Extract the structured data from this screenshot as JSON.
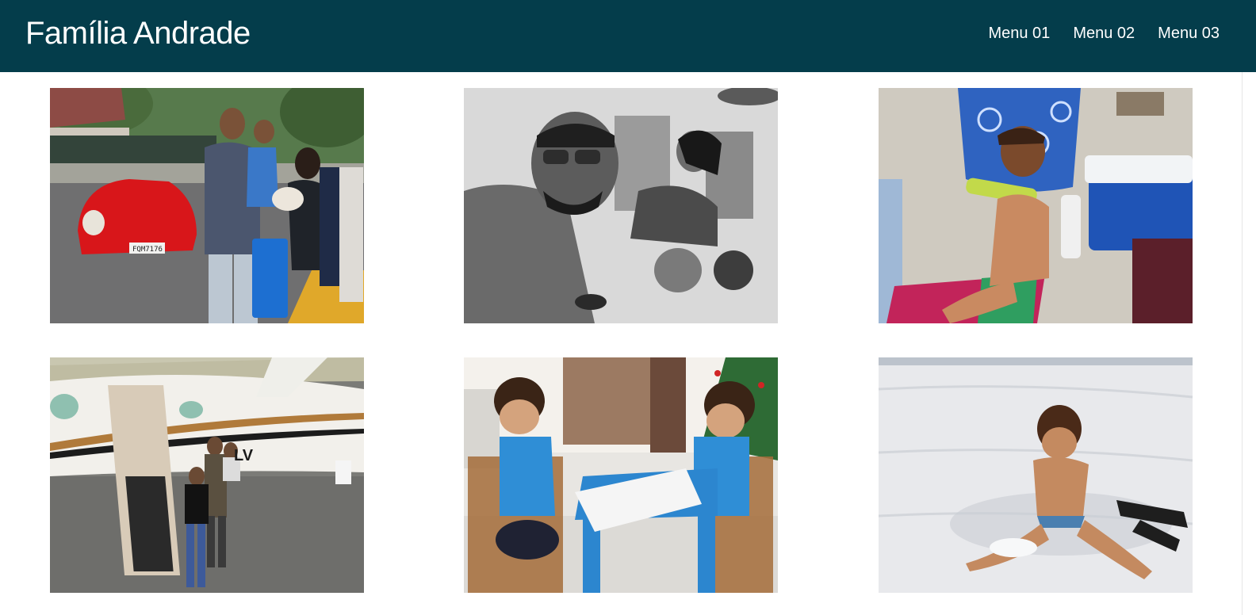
{
  "header": {
    "title": "Família Andrade",
    "menu": [
      {
        "label": "Menu 01"
      },
      {
        "label": "Menu 02"
      },
      {
        "label": "Menu 03"
      }
    ]
  },
  "colors": {
    "header_bg": "#043d4b",
    "header_text": "#ffffff",
    "page_bg": "#ffffff"
  },
  "gallery": {
    "photos": [
      {
        "subject": "family with red classic car",
        "plate_text": "FQM7176"
      },
      {
        "subject": "black and white beach selfie"
      },
      {
        "subject": "child in beach chair with cooler"
      },
      {
        "subject": "family next to private jet",
        "aircraft_mark": "LV"
      },
      {
        "subject": "two children drawing at blue table"
      },
      {
        "subject": "child playing in sand"
      }
    ]
  }
}
